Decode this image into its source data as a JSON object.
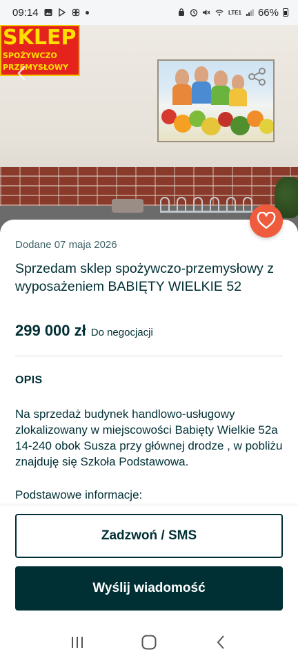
{
  "status_bar": {
    "time": "09:14",
    "network": "LTE1",
    "battery": "66%"
  },
  "photo": {
    "sign_main": "SKLEP",
    "sign_line1": "SPOŻYWCZO",
    "sign_line2": "PRZEMYSŁOWY"
  },
  "listing": {
    "date": "Dodane 07 maja 2026",
    "title": "Sprzedam sklep spożywczo-przemysłowy z wyposażeniem BABIĘTY WIELKIE 52",
    "price": "299 000 zł",
    "negotiation": "Do negocjacji",
    "description_heading": "OPIS",
    "description": "Na sprzedaż budynek handlowo-usługowy zlokalizowany w miejscowości Babięty Wielkie 52a 14-240 obok Susza przy głównej drodze , w pobliżu znajduję się Szkoła Podstawowa.",
    "basic_info_label": "Podstawowe informacje:"
  },
  "actions": {
    "call_label": "Zadzwoń / SMS",
    "message_label": "Wyślij wiadomość"
  },
  "colors": {
    "brand_dark": "#002f34",
    "favorite": "#ef5b3d"
  },
  "icons": [
    "gallery-icon",
    "share-icon",
    "heart-icon",
    "recent-apps-icon",
    "home-icon",
    "back-icon"
  ]
}
